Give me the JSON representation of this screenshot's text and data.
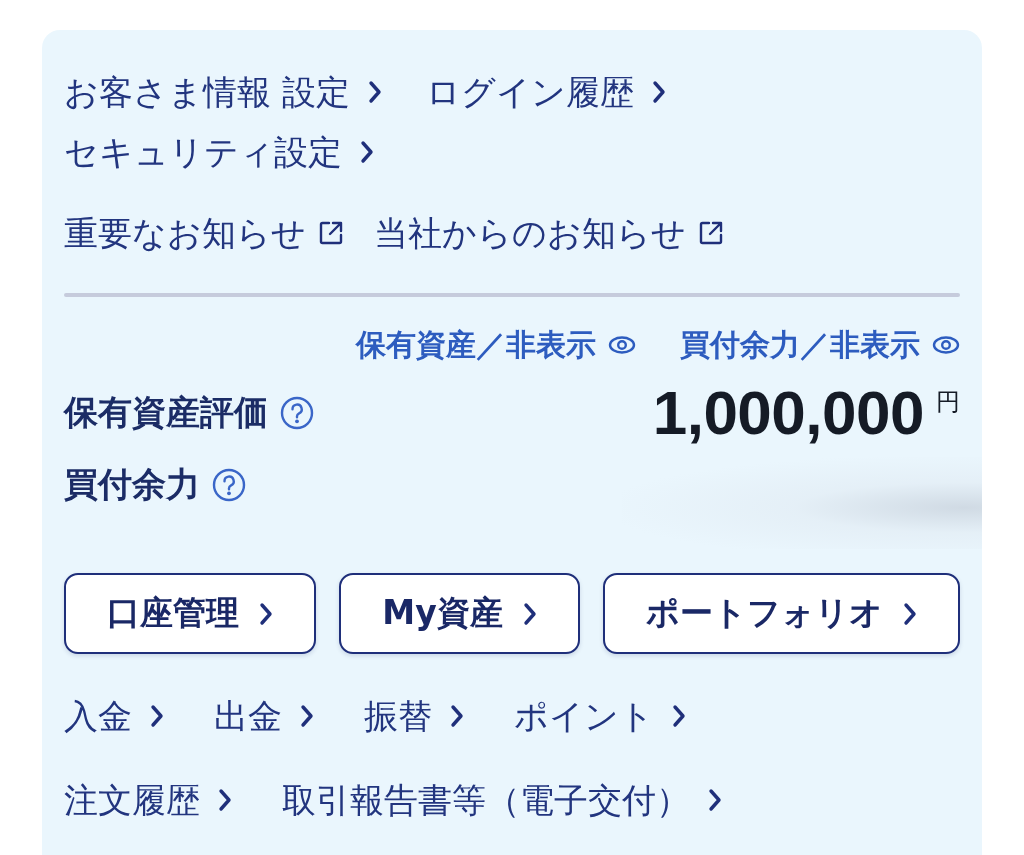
{
  "settings_links": [
    {
      "label": "お客さま情報 設定"
    },
    {
      "label": "ログイン履歴"
    },
    {
      "label": "セキュリティ設定"
    }
  ],
  "notices": [
    {
      "label": "重要なお知らせ"
    },
    {
      "label": "当社からのお知らせ"
    }
  ],
  "visibility_toggles": [
    {
      "label": "保有資産／非表示"
    },
    {
      "label": "買付余力／非表示"
    }
  ],
  "summary": [
    {
      "label": "保有資産評価",
      "value": "1,000,000",
      "unit": "円"
    },
    {
      "label": "買付余力"
    }
  ],
  "buttons": [
    {
      "label": "口座管理"
    },
    {
      "label": "My資産"
    },
    {
      "label": "ポートフォリオ"
    }
  ],
  "link_rows": [
    [
      {
        "label": "入金"
      },
      {
        "label": "出金"
      },
      {
        "label": "振替"
      },
      {
        "label": "ポイント"
      }
    ],
    [
      {
        "label": "注文履歴"
      },
      {
        "label": "取引報告書等（電子交付）"
      }
    ]
  ]
}
